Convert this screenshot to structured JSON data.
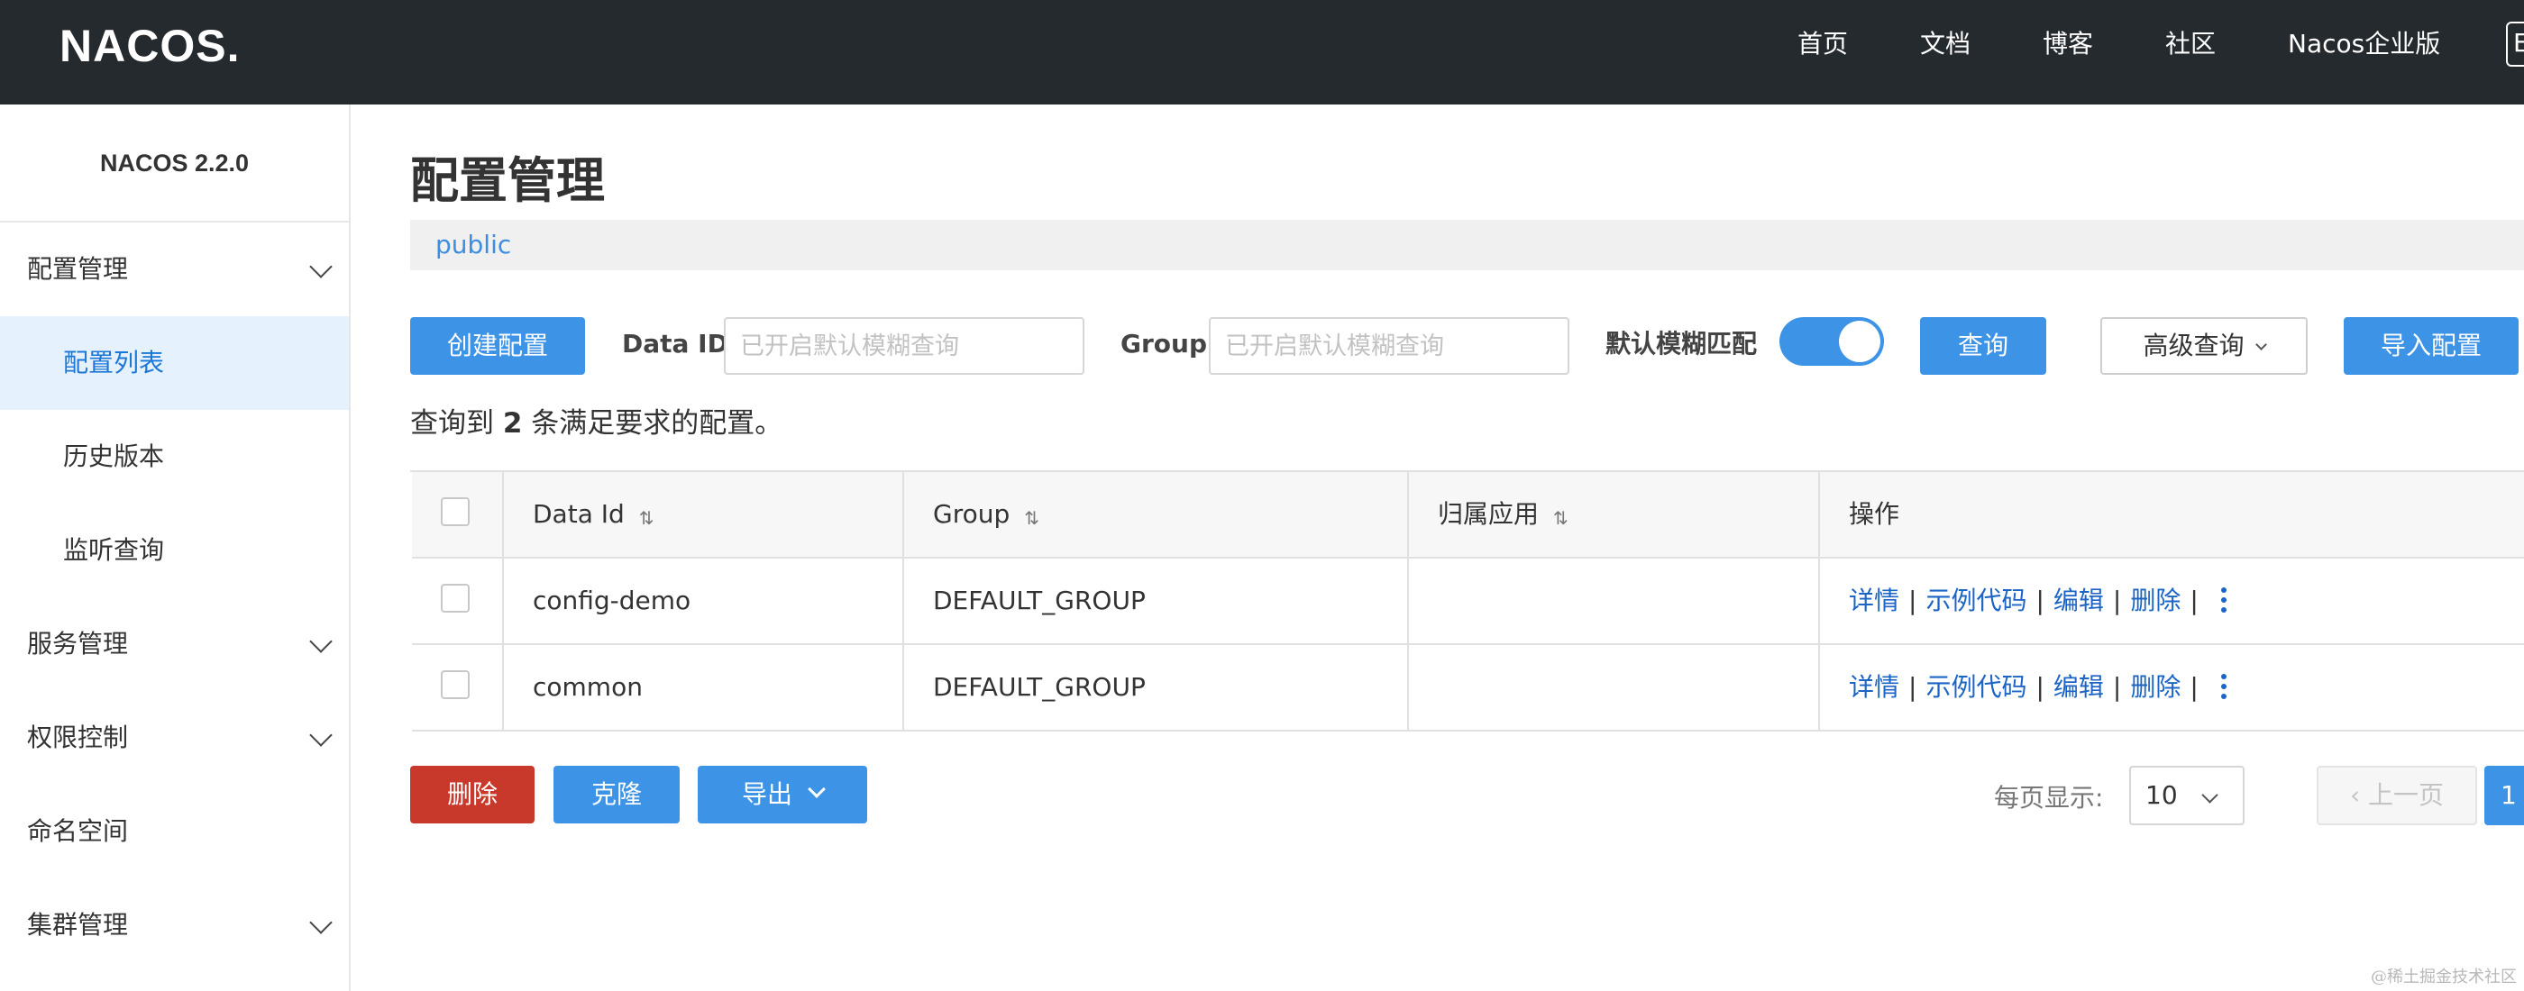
{
  "header": {
    "logo": "NACOS.",
    "nav": [
      "首页",
      "文档",
      "博客",
      "社区",
      "Nacos企业版"
    ],
    "lang_button": "En"
  },
  "sidebar": {
    "version": "NACOS 2.2.0",
    "items": [
      {
        "label": "配置管理",
        "type": "group",
        "expanded": true
      },
      {
        "label": "配置列表",
        "type": "sub",
        "active": true
      },
      {
        "label": "历史版本",
        "type": "sub"
      },
      {
        "label": "监听查询",
        "type": "sub"
      },
      {
        "label": "服务管理",
        "type": "group"
      },
      {
        "label": "权限控制",
        "type": "group"
      },
      {
        "label": "命名空间",
        "type": "item"
      },
      {
        "label": "集群管理",
        "type": "group"
      }
    ]
  },
  "main": {
    "title": "配置管理",
    "namespace": "public",
    "toolbar": {
      "create_label": "创建配置",
      "dataid_label": "Data ID",
      "dataid_placeholder": "已开启默认模糊查询",
      "group_label": "Group",
      "group_placeholder": "已开启默认模糊查询",
      "fuzzy_label": "默认模糊匹配",
      "fuzzy_on": true,
      "query_label": "查询",
      "advanced_label": "高级查询",
      "import_label": "导入配置"
    },
    "result": {
      "prefix": "查询到",
      "count": "2",
      "suffix": "条满足要求的配置。"
    },
    "table": {
      "columns": [
        "Data Id",
        "Group",
        "归属应用",
        "操作"
      ],
      "rows": [
        {
          "data_id": "config-demo",
          "group": "DEFAULT_GROUP",
          "app": ""
        },
        {
          "data_id": "common",
          "group": "DEFAULT_GROUP",
          "app": ""
        }
      ],
      "ops": [
        "详情",
        "示例代码",
        "编辑",
        "删除"
      ]
    },
    "bulk": {
      "delete_label": "删除",
      "clone_label": "克隆",
      "export_label": "导出"
    },
    "pagination": {
      "page_size_label": "每页显示:",
      "page_size": "10",
      "prev_label": "上一页",
      "current_page": "1"
    }
  },
  "watermark": "@稀土掘金技术社区",
  "colors": {
    "header_bg": "#252a2f",
    "primary": "#3d93e6",
    "danger": "#c9392b",
    "link": "#1c64c6",
    "active_bg": "#e5f1fc"
  }
}
